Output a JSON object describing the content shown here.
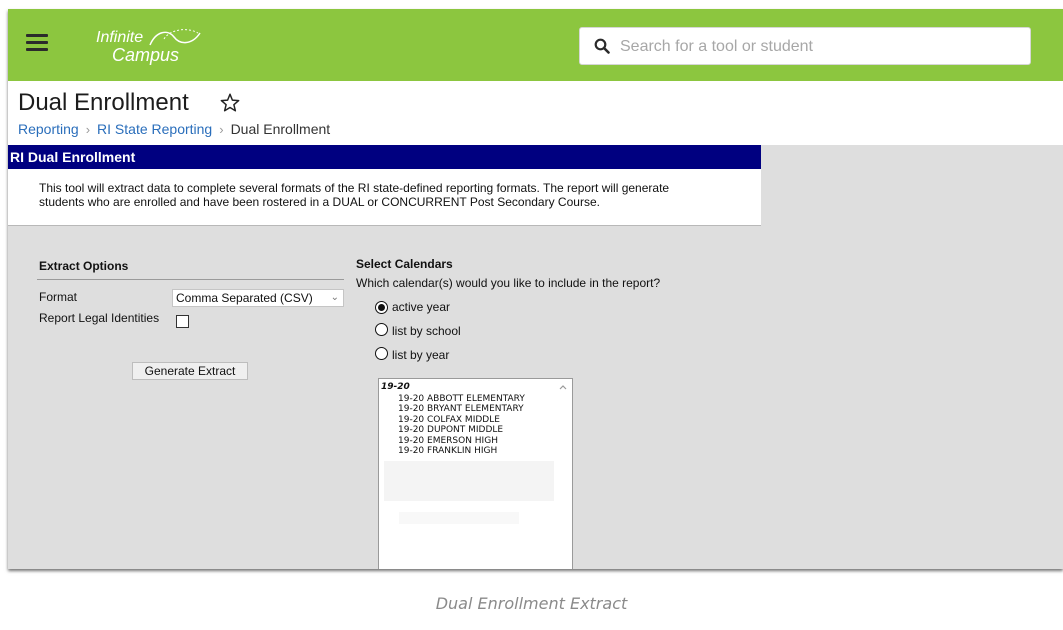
{
  "topbar": {
    "logo_line1": "Infinite",
    "logo_line2": "Campus",
    "search_placeholder": "Search for a tool or student",
    "brand_color": "#8cc63f"
  },
  "page": {
    "title": "Dual Enrollment",
    "breadcrumb": [
      "Reporting",
      "RI State Reporting",
      "Dual Enrollment"
    ]
  },
  "panel": {
    "header": "RI Dual Enrollment",
    "header_color": "#000080",
    "description_lines": [
      "This tool will extract data to complete several formats of the RI state-defined reporting formats. The report will generate",
      "students who are enrolled and have been rostered in a DUAL or CONCURRENT Post Secondary Course."
    ]
  },
  "extract_options": {
    "title": "Extract Options",
    "format_label": "Format",
    "format_value": "Comma Separated (CSV)",
    "legal_identities_label": "Report Legal Identities",
    "legal_identities_checked": false,
    "generate_button": "Generate Extract"
  },
  "calendars": {
    "title": "Select Calendars",
    "prompt": "Which calendar(s) would you like to include in the report?",
    "options": [
      {
        "label": "active year",
        "selected": true
      },
      {
        "label": "list by school",
        "selected": false
      },
      {
        "label": "list by year",
        "selected": false
      }
    ],
    "list_group": "19-20",
    "list_items": [
      "19-20 ABBOTT ELEMENTARY",
      "19-20 BRYANT ELEMENTARY",
      "19-20 COLFAX MIDDLE",
      "19-20 DUPONT MIDDLE",
      "19-20 EMERSON HIGH",
      "19-20 FRANKLIN HIGH"
    ]
  },
  "caption": "Dual Enrollment Extract"
}
